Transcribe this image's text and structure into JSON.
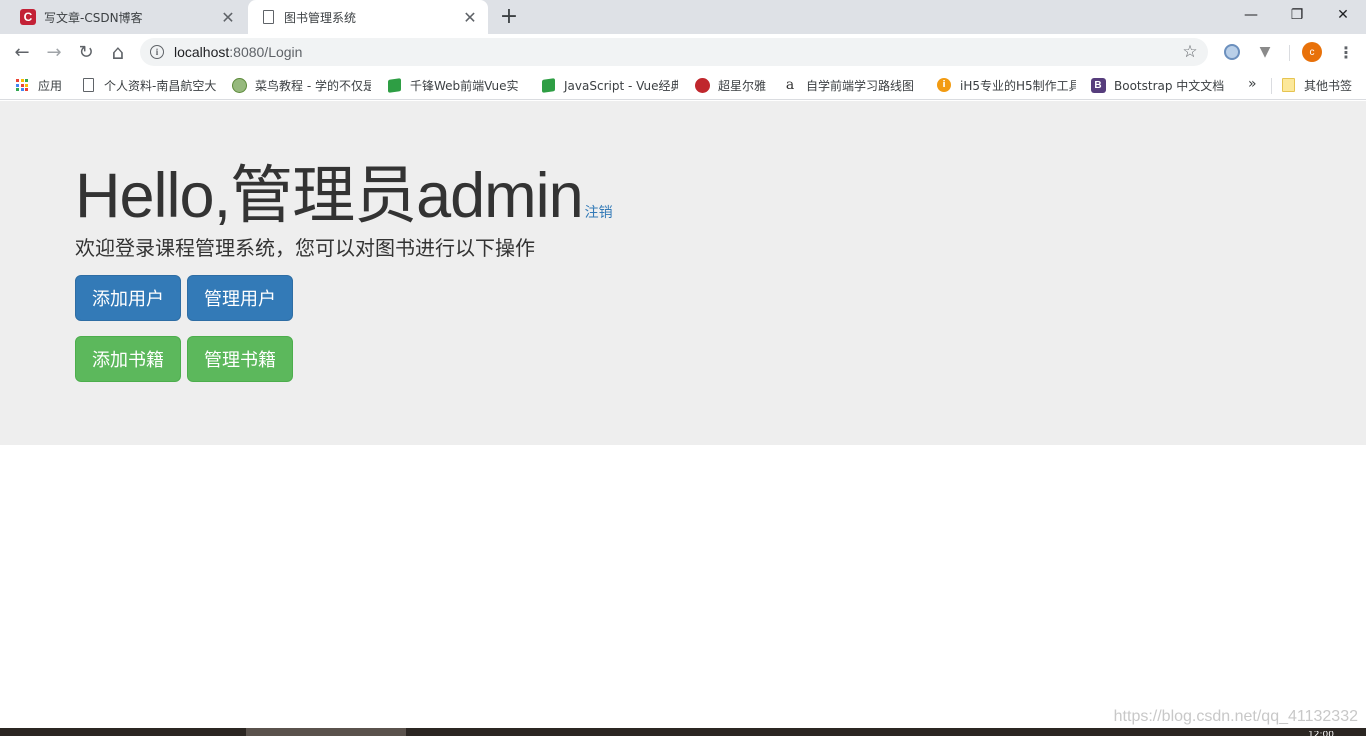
{
  "browser": {
    "tabs": [
      {
        "title": "写文章-CSDN博客",
        "favicon": "csdn-icon",
        "active": false
      },
      {
        "title": "图书管理系统",
        "favicon": "page-icon",
        "active": true
      }
    ],
    "new_tab_symbol": "+",
    "close_symbol": "✕",
    "window": {
      "minimize": "—",
      "restore": "❐",
      "close": "✕"
    },
    "nav": {
      "back": "←",
      "forward": "→",
      "reload": "↻",
      "home": "⌂"
    },
    "url_host": "localhost",
    "url_rest": ":8080/Login",
    "info_symbol": "i",
    "star_symbol": "☆",
    "profile_initial": "c",
    "menu_symbol": "⋮",
    "bookmarks": [
      {
        "label": "应用",
        "icon": "apps-grid-icon"
      },
      {
        "label": "个人资料-南昌航空大",
        "icon": "page-icon"
      },
      {
        "label": "菜鸟教程 - 学的不仅是",
        "icon": "runoob-icon"
      },
      {
        "label": "千锋Web前端Vue实",
        "icon": "green-book-icon"
      },
      {
        "label": "JavaScript - Vue经典",
        "icon": "green-book-icon"
      },
      {
        "label": "超星尔雅",
        "icon": "chaoxing-icon"
      },
      {
        "label": "自学前端学习路线图",
        "icon": "a-icon"
      },
      {
        "label": "iH5专业的H5制作工具",
        "icon": "ih5-icon"
      },
      {
        "label": "Bootstrap 中文文档",
        "icon": "bootstrap-icon"
      },
      {
        "label": "其他书签",
        "icon": "folder-icon"
      }
    ],
    "bookmarks_more": "»"
  },
  "page": {
    "title": "Hello,管理员admin",
    "logout": "注销",
    "subtitle": "欢迎登录课程管理系统，您可以对图书进行以下操作",
    "buttons": {
      "add_user": "添加用户",
      "manage_user": "管理用户",
      "add_book": "添加书籍",
      "manage_book": "管理书籍"
    }
  },
  "watermark": "https://blog.csdn.net/qq_41132332",
  "clock_fragment": "12:00",
  "colors": {
    "primary": "#337ab7",
    "success": "#5cb85c",
    "jumbotron": "#eeeeee",
    "link": "#337ab7"
  }
}
